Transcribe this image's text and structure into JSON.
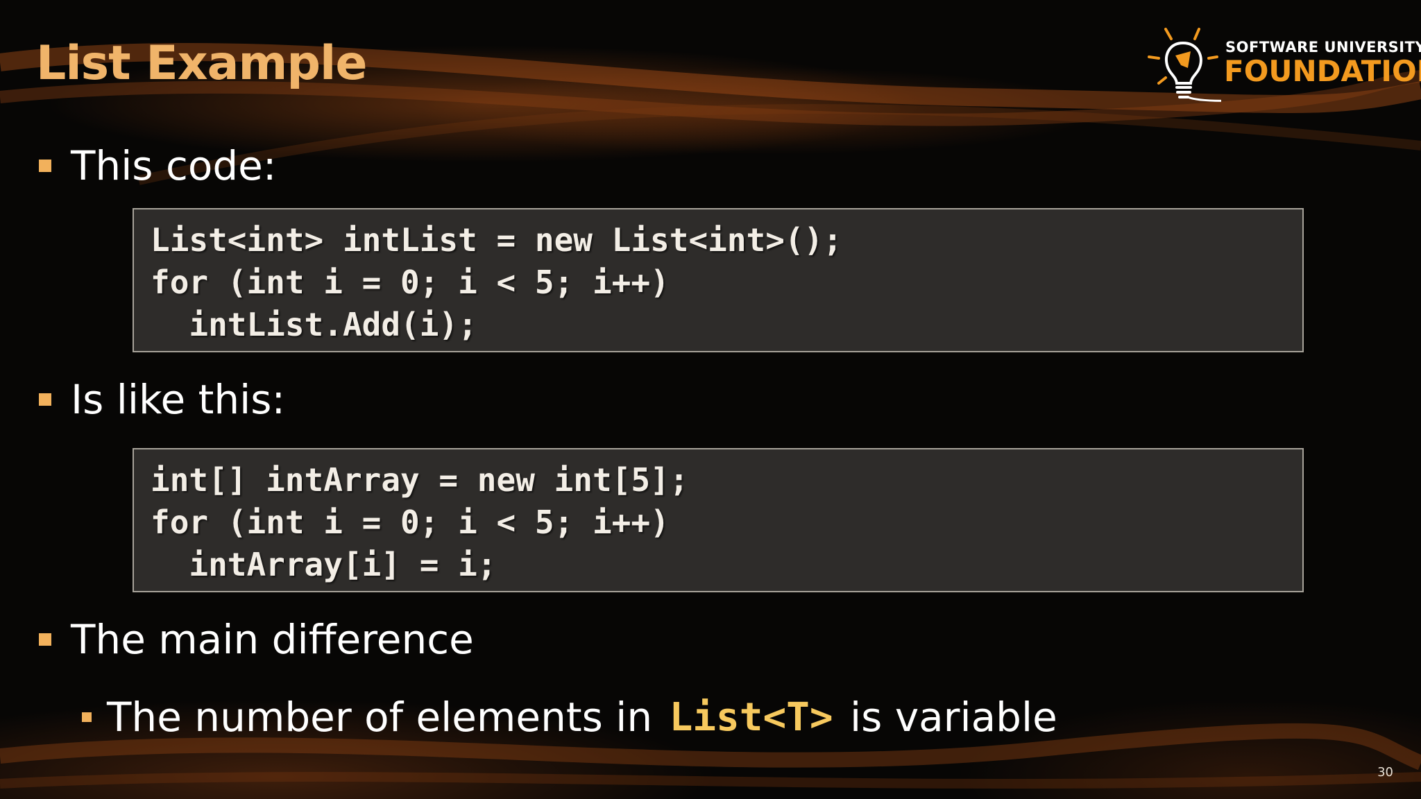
{
  "slide": {
    "title": "List Example",
    "page_number": "30"
  },
  "logo": {
    "line1": "SOFTWARE UNIVERSITY",
    "line2": "FOUNDATION",
    "icon": "lightbulb-icon"
  },
  "bullets": [
    {
      "text": "This code:"
    },
    {
      "text": "Is like this:"
    },
    {
      "text": "The main difference"
    }
  ],
  "sub_bullet": {
    "text_before": "The number of elements in ",
    "code": "List<T>",
    "text_after": " is variable"
  },
  "code_blocks": [
    {
      "lines": [
        "List<int> intList = new List<int>();",
        "for (int i = 0; i < 5; i++)",
        "  intList.Add(i);"
      ]
    },
    {
      "lines": [
        "int[] intArray = new int[5];",
        "for (int i = 0; i < 5; i++)",
        "  intArray[i] = i;"
      ]
    }
  ],
  "colors": {
    "title": "#f0b46a",
    "bullet": "#f2b15c",
    "code_highlight": "#f7c95e",
    "logo_orange": "#f39a1f",
    "code_bg": "#2e2c2a"
  }
}
